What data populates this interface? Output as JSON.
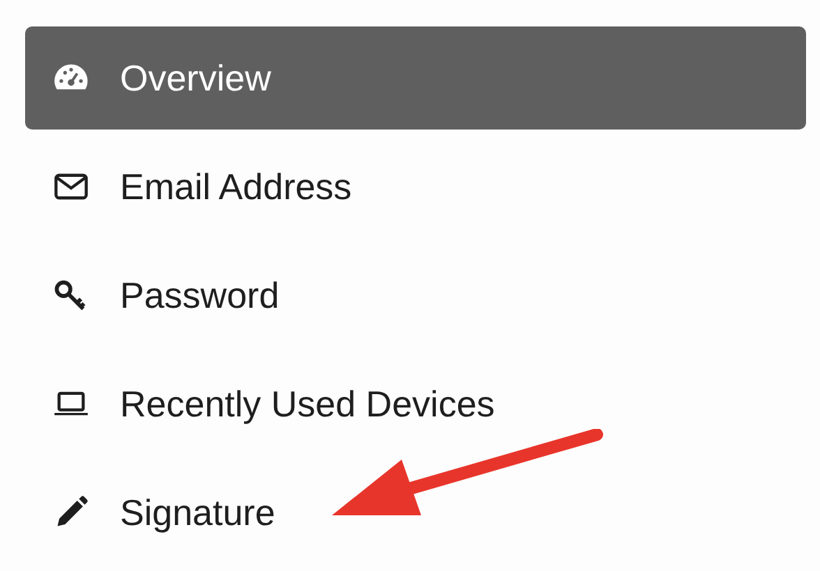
{
  "menu": {
    "items": [
      {
        "label": "Overview",
        "selected": true
      },
      {
        "label": "Email Address",
        "selected": false
      },
      {
        "label": "Password",
        "selected": false
      },
      {
        "label": "Recently Used Devices",
        "selected": false
      },
      {
        "label": "Signature",
        "selected": false
      }
    ]
  }
}
